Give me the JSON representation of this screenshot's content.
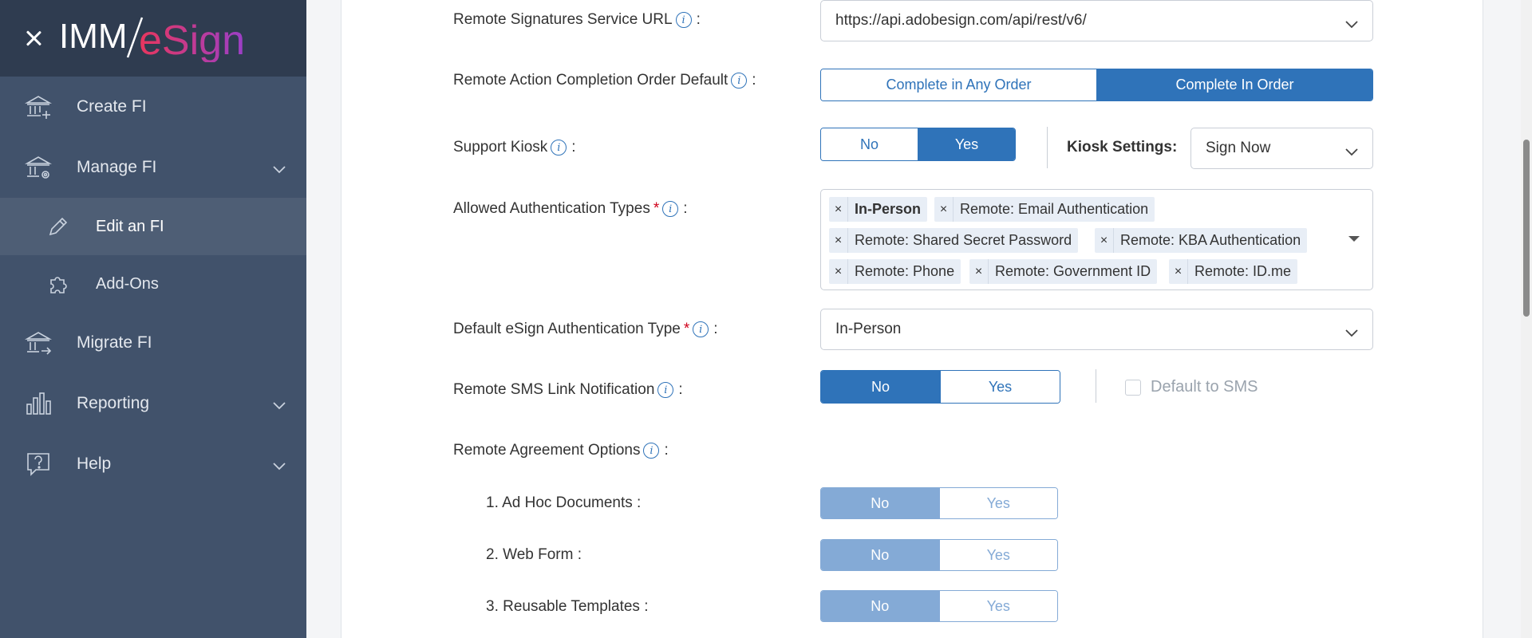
{
  "brand": {
    "part1": "IMM",
    "part2": "eSign"
  },
  "sidebar": {
    "items": [
      {
        "label": "Create FI",
        "icon": "bank-add-icon"
      },
      {
        "label": "Manage FI",
        "icon": "bank-settings-icon",
        "expandable": true
      },
      {
        "label": "Edit an FI",
        "icon": "pencil-icon",
        "sub": true,
        "active": true
      },
      {
        "label": "Add-Ons",
        "icon": "puzzle-icon",
        "sub": true
      },
      {
        "label": "Migrate FI",
        "icon": "bank-migrate-icon"
      },
      {
        "label": "Reporting",
        "icon": "bar-chart-icon",
        "expandable": true
      },
      {
        "label": "Help",
        "icon": "help-icon",
        "expandable": true
      }
    ]
  },
  "form": {
    "service_url": {
      "label": "Remote Signatures Service URL",
      "value": "https://api.adobesign.com/api/rest/v6/"
    },
    "completion_order": {
      "label": "Remote Action Completion Order Default",
      "options": [
        "Complete in Any Order",
        "Complete In Order"
      ],
      "selected": "Complete In Order"
    },
    "support_kiosk": {
      "label": "Support Kiosk",
      "options": [
        "No",
        "Yes"
      ],
      "selected": "Yes"
    },
    "kiosk_settings": {
      "label": "Kiosk Settings:",
      "value": "Sign Now"
    },
    "auth_types": {
      "label": "Allowed Authentication Types",
      "tags": [
        "In-Person",
        "Remote: Email Authentication",
        "Remote: Shared Secret Password",
        "Remote: KBA Authentication",
        "Remote: Phone",
        "Remote: Government ID",
        "Remote: ID.me"
      ]
    },
    "default_auth": {
      "label": "Default eSign Authentication Type",
      "value": "In-Person"
    },
    "sms_notification": {
      "label": "Remote SMS Link Notification",
      "options": [
        "No",
        "Yes"
      ],
      "selected": "No"
    },
    "default_sms": {
      "label": "Default to SMS",
      "checked": false
    },
    "agreement_options": {
      "label": "Remote Agreement Options",
      "items": [
        {
          "label": "1. Ad Hoc Documents :",
          "options": [
            "No",
            "Yes"
          ],
          "selected": "No"
        },
        {
          "label": "2. Web Form :",
          "options": [
            "No",
            "Yes"
          ],
          "selected": "No"
        },
        {
          "label": "3. Reusable Templates :",
          "options": [
            "No",
            "Yes"
          ],
          "selected": "No"
        }
      ]
    }
  },
  "colors": {
    "sidebar": "#41526b",
    "sidebar_header": "#2f3c50",
    "accent": "#2f73b9",
    "required": "#d0021b"
  }
}
